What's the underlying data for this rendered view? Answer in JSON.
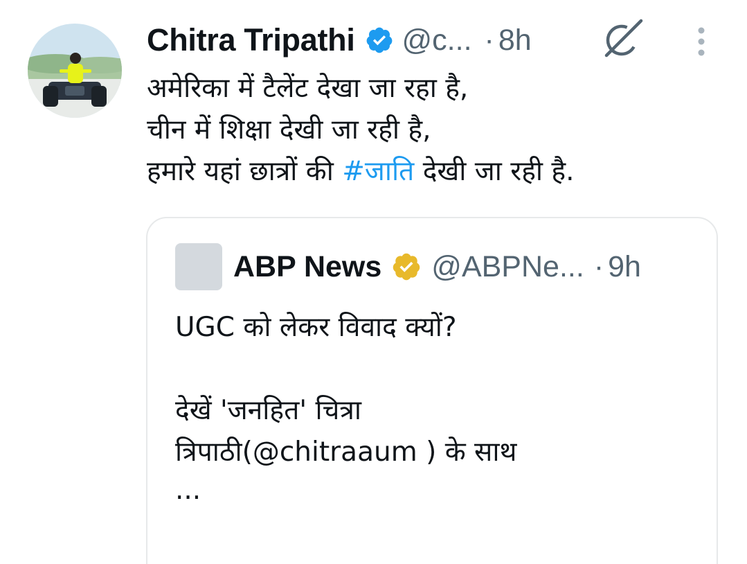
{
  "tweet": {
    "author_name": "Chitra Tripathi",
    "handle": "@c...",
    "separator": "·",
    "time": "8h",
    "text_line1": "अमेरिका में टैलेंट देखा जा रहा है,",
    "text_line2": "चीन में शिक्षा देखी जा रही है,",
    "text_line3_before": "हमारे यहां छात्रों की ",
    "hashtag": "#जाति",
    "text_line3_after": " देखी जा रही है.",
    "verified_color": "#1d9bf0",
    "icons": [
      "verified-badge-icon",
      "grok-icon",
      "more-options-icon"
    ]
  },
  "quoted_tweet": {
    "author_name": "ABP News",
    "handle": "@ABPNe...",
    "separator": "·",
    "time": "9h",
    "text_line1": "UGC को लेकर विवाद क्यों?",
    "text_line2": "देखें 'जनहित' चित्रा",
    "text_line3": "त्रिपाठी(@chitraaum ) के साथ",
    "ellipsis": "...",
    "verified_color": "#e8b92b",
    "icons": [
      "gold-verified-badge-icon"
    ]
  },
  "colors": {
    "text": "#0f1419",
    "secondary": "#536471",
    "link": "#1d9bf0",
    "border": "#e7e9ea"
  }
}
